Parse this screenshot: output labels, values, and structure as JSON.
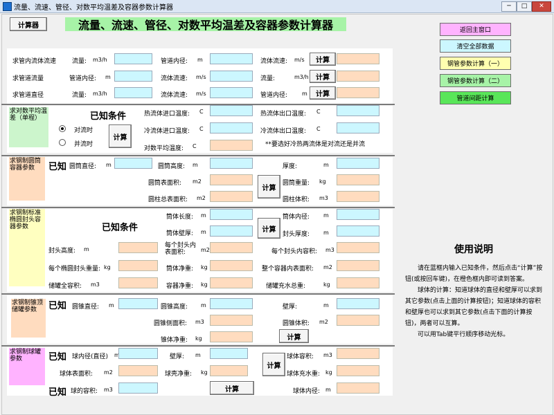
{
  "window": {
    "title": "流量、流速、管径、对数平均温差及容器参数计算器"
  },
  "header": {
    "calc_button": "计算器",
    "title": "流量、流速、管径、对数平均温差及容器参数计算器"
  },
  "nav": {
    "back": "返回主窗口",
    "clear": "清空全部数据",
    "steel1": "钢管参数计算（一）",
    "steel2": "钢管参数计算（二）",
    "spacing": "管道间距计算"
  },
  "pipe": {
    "r1_tag": "求管内流体流速",
    "r1_flow": "流量:",
    "r1_flow_u": "m3/h",
    "r1_dia": "管道内径:",
    "r1_dia_u": "m",
    "r1_vel": "流体流速:",
    "r1_vel_u": "m/s",
    "r2_tag": "求管道流量",
    "r2_dia": "管道内径:",
    "r2_dia_u": "m",
    "r2_vel": "流体流速:",
    "r2_vel_u": "m/s",
    "r2_flow": "流量:",
    "r2_flow_u": "m3/h",
    "r3_tag": "求管道直径",
    "r3_flow": "流量:",
    "r3_flow_u": "m3/h",
    "r3_vel": "流体流速:",
    "r3_vel_u": "m/s",
    "r3_dia": "管道内径:",
    "r3_dia_u": "m",
    "calc": "计算"
  },
  "lmtd": {
    "tag": "求对数平均温差（单程）",
    "known": "已知条件",
    "counter": "对流时",
    "parallel": "并流时",
    "calc": "计算",
    "hot_in": "热流体进口温度:",
    "hot_out": "热流体出口温度:",
    "cold_in": "冷流体进口温度:",
    "cold_out": "冷流体出口温度:",
    "lmtd": "对数平均温度:",
    "unit_c": "C",
    "note": "**要选好冷热两流体是对流还是并流"
  },
  "cyl": {
    "tag": "求钢制圆筒容器参数",
    "known": "已知",
    "dia": "圆筒直径:",
    "height": "圆筒高度:",
    "thick": "厚度:",
    "surface": "圆筒表面积:",
    "weight": "圆筒重量:",
    "total_surface": "圆柱总表面积:",
    "volume": "圆柱体积:",
    "u_m": "m",
    "u_m2": "m2",
    "u_kg": "kg",
    "u_m3": "m3",
    "calc": "计算"
  },
  "ell": {
    "tag": "求钢制标准椭圆封头容器参数",
    "known": "已知条件",
    "body_len": "筒体长度:",
    "inner_dia": "筒体内径:",
    "body_wall": "筒体壁厚:",
    "head_thick": "封头厚度:",
    "head_height": "封头高度:",
    "head_area": "每个封头内表面积:",
    "head_vol": "每个封头内容积:",
    "head_weight": "每个椭圆封头重量:",
    "body_weight": "筒体净重:",
    "inner_area": "整个容器内表面积:",
    "full_vol": "储罐全容积:",
    "vessel_weight": "容器净重:",
    "water_weight": "储罐充水总重:",
    "u_m": "m",
    "u_m2": "m2",
    "u_kg": "kg",
    "u_m3": "m3",
    "calc": "计算"
  },
  "cone": {
    "tag": "求钢制锥顶储罐参数",
    "known": "已知",
    "dia": "圆锥直径:",
    "height": "圆锥高度:",
    "wall": "壁厚:",
    "side_area": "圆锥侧面积:",
    "volume": "圆锥体积:",
    "weight": "锥体净重:",
    "u_m": "m",
    "u_m2": "m2",
    "u_m3": "m3",
    "u_kg": "kg",
    "calc": "计算"
  },
  "sphere": {
    "tag": "求钢制球罐参数",
    "known": "已知",
    "known2": "已知",
    "inner_dia": "球内径(直径)",
    "wall": "壁厚:",
    "volume": "球体容积:",
    "surface": "球体表面积:",
    "shell_weight": "球壳净重:",
    "water_weight": "球体充水重:",
    "capacity": "球的容积:",
    "inner_dia2": "球体内径:",
    "u_m": "m",
    "u_m2": "m2",
    "u_m3": "m3",
    "u_kg": "kg",
    "calc": "计算"
  },
  "help": {
    "title": "使用说明",
    "p1": "请在蓝框内输入已知条件，然后点击“计算”按钮(或按回车键)，在橙色框内即可读到答案。",
    "p2": "球体的计算：知道球体的直径和壁厚可以求到其它参数(点击上面的计算按钮)；知道球体的容积和壁厚也可以求到其它参数(点击下面的计算按钮)，两者可以互算。",
    "p3": "可以用Tab键平行顺序移动光标。"
  }
}
